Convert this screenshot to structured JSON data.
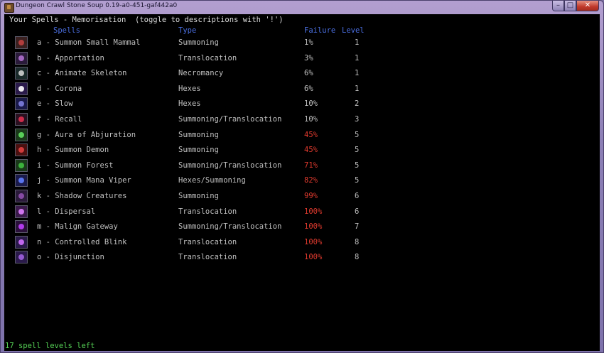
{
  "window": {
    "title": "Dungeon Crawl Stone Soup 0.19-a0-451-gaf442a0"
  },
  "header": "Your Spells - Memorisation  (toggle to descriptions with '!')",
  "columns": {
    "spells": "Spells",
    "type": "Type",
    "failure": "Failure",
    "level": "Level"
  },
  "spells": [
    {
      "name": "a - Summon Small Mammal",
      "type": "Summoning",
      "failure": "1%",
      "level": "1",
      "high": false,
      "icon": "summon-small-mammal-icon",
      "bg": "#3a2020",
      "glyph": "#c04040"
    },
    {
      "name": "b - Apportation",
      "type": "Translocation",
      "failure": "3%",
      "level": "1",
      "high": false,
      "icon": "apportation-icon",
      "bg": "#2a1a3a",
      "glyph": "#b070d0"
    },
    {
      "name": "c - Animate Skeleton",
      "type": "Necromancy",
      "failure": "6%",
      "level": "1",
      "high": false,
      "icon": "animate-skeleton-icon",
      "bg": "#1a2a2a",
      "glyph": "#d0d0d0"
    },
    {
      "name": "d - Corona",
      "type": "Hexes",
      "failure": "6%",
      "level": "1",
      "high": false,
      "icon": "corona-icon",
      "bg": "#2a1a4a",
      "glyph": "#ffffff"
    },
    {
      "name": "e - Slow",
      "type": "Hexes",
      "failure": "10%",
      "level": "2",
      "high": false,
      "icon": "slow-icon",
      "bg": "#1a1a4a",
      "glyph": "#8080e0"
    },
    {
      "name": "f - Recall",
      "type": "Summoning/Translocation",
      "failure": "10%",
      "level": "3",
      "high": false,
      "icon": "recall-icon",
      "bg": "#2a1020",
      "glyph": "#e03050"
    },
    {
      "name": "g - Aura of Abjuration",
      "type": "Summoning",
      "failure": "45%",
      "level": "5",
      "high": true,
      "icon": "aura-of-abjuration-icon",
      "bg": "#1a3a1a",
      "glyph": "#60e060"
    },
    {
      "name": "h - Summon Demon",
      "type": "Summoning",
      "failure": "45%",
      "level": "5",
      "high": true,
      "icon": "summon-demon-icon",
      "bg": "#4a1010",
      "glyph": "#e04040"
    },
    {
      "name": "i - Summon Forest",
      "type": "Summoning/Translocation",
      "failure": "71%",
      "level": "5",
      "high": true,
      "icon": "summon-forest-icon",
      "bg": "#1a3a1a",
      "glyph": "#40c040"
    },
    {
      "name": "j - Summon Mana Viper",
      "type": "Hexes/Summoning",
      "failure": "82%",
      "level": "5",
      "high": true,
      "icon": "summon-mana-viper-icon",
      "bg": "#1a1a4a",
      "glyph": "#6080ff"
    },
    {
      "name": "k - Shadow Creatures",
      "type": "Summoning",
      "failure": "99%",
      "level": "6",
      "high": true,
      "icon": "shadow-creatures-icon",
      "bg": "#2a1a3a",
      "glyph": "#9050b0"
    },
    {
      "name": "l - Dispersal",
      "type": "Translocation",
      "failure": "100%",
      "level": "6",
      "high": true,
      "icon": "dispersal-icon",
      "bg": "#3a1a4a",
      "glyph": "#e080ff"
    },
    {
      "name": "m - Malign Gateway",
      "type": "Summoning/Translocation",
      "failure": "100%",
      "level": "7",
      "high": true,
      "icon": "malign-gateway-icon",
      "bg": "#2a103a",
      "glyph": "#c040ff"
    },
    {
      "name": "n - Controlled Blink",
      "type": "Translocation",
      "failure": "100%",
      "level": "8",
      "high": true,
      "icon": "controlled-blink-icon",
      "bg": "#2a1a4a",
      "glyph": "#d070ff"
    },
    {
      "name": "o - Disjunction",
      "type": "Translocation",
      "failure": "100%",
      "level": "8",
      "high": true,
      "icon": "disjunction-icon",
      "bg": "#2a1a4a",
      "glyph": "#a060e0"
    }
  ],
  "footer": "17 spell levels left",
  "colors": {
    "column_header": "#4a6ee0",
    "fail_high": "#e03a2e",
    "footer": "#55d055"
  }
}
